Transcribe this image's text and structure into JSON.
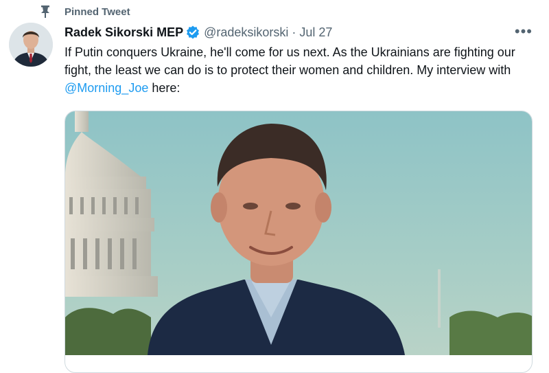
{
  "pinned": {
    "label": "Pinned Tweet",
    "icon": "pin-icon"
  },
  "author": {
    "display_name": "Radek Sikorski MEP",
    "verified_icon": "verified-badge-icon",
    "handle": "@radeksikorski",
    "separator": "·",
    "date": "Jul 27"
  },
  "tweet": {
    "text_before": "If Putin conquers Ukraine, he'll come for us next. As the Ukrainians are fighting our fight, the least we can do is to protect their women and children. My interview with ",
    "mention": "@Morning_Joe",
    "text_after": " here:"
  },
  "menu": {
    "more_label": "•••"
  },
  "colors": {
    "accent": "#1d9bf0",
    "secondary_text": "#536471",
    "border": "#cfd9de"
  }
}
